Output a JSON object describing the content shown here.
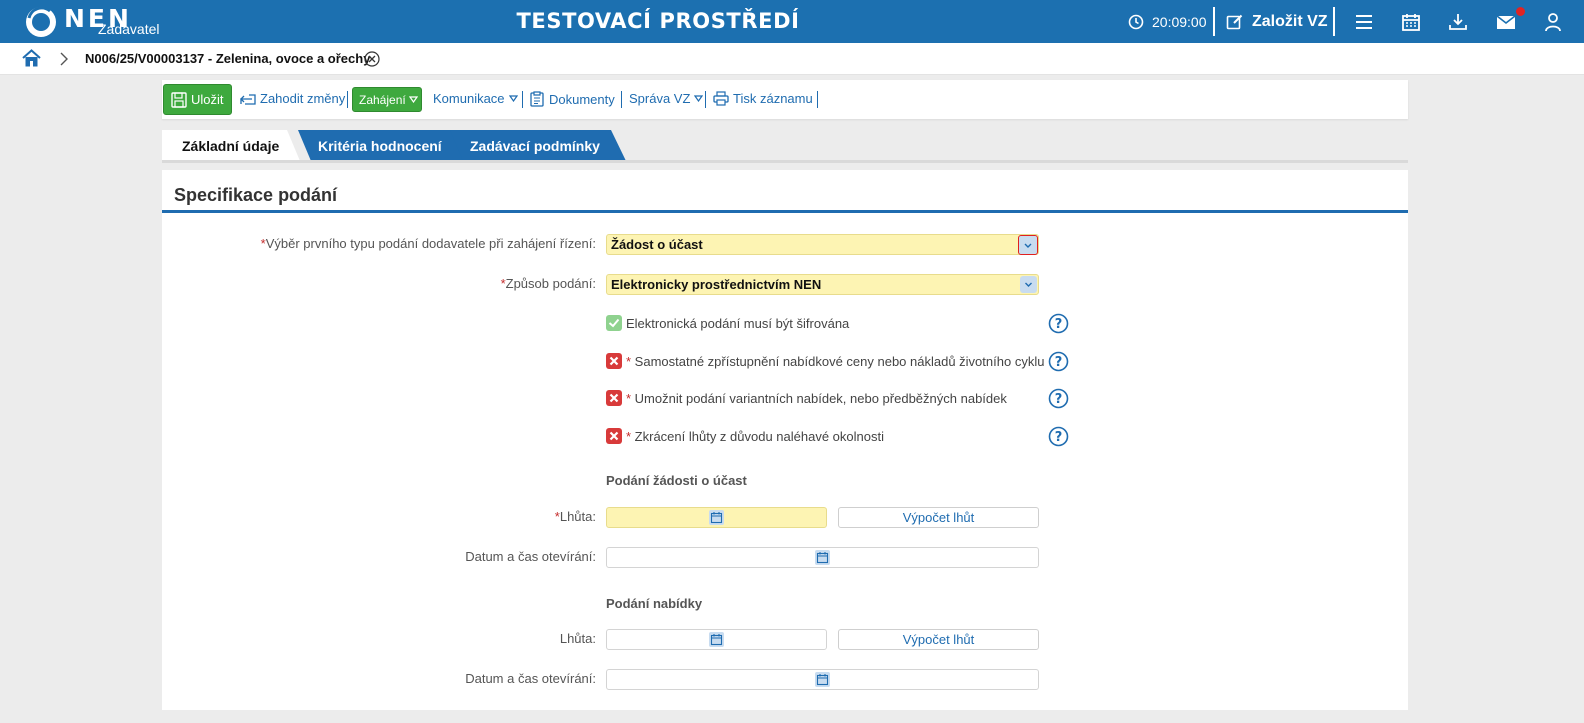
{
  "header": {
    "logo_text": "NEN",
    "logo_sub": "Zadavatel",
    "env_title": "TESTOVACÍ PROSTŘEDÍ",
    "time": "20:09:00",
    "create_label": "Založit VZ"
  },
  "breadcrumb": {
    "title": "N006/25/V00003137 - Zelenina, ovoce a ořechy"
  },
  "toolbar": {
    "save_label": "Uložit",
    "discard_label": "Zahodit změny",
    "start_label": "Zahájení",
    "communication_label": "Komunikace",
    "documents_label": "Dokumenty",
    "management_label": "Správa VZ",
    "print_label": "Tisk záznamu"
  },
  "tabs": [
    {
      "label": "Základní údaje",
      "active": true
    },
    {
      "label": "Kritéria hodnocení",
      "active": false
    },
    {
      "label": "Zadávací podmínky",
      "active": false
    }
  ],
  "form": {
    "section_title": "Specifikace podání",
    "first_type_label": "Výběr prvního typu podání dodavatele při zahájení řízení:",
    "first_type_value": "Žádost o účast",
    "method_label": "Způsob podání:",
    "method_value": "Elektronicky prostřednictvím NEN",
    "checks": [
      {
        "label": "Elektronická podání musí být šifrována",
        "checked": true,
        "required": false
      },
      {
        "label": "Samostatné zpřístupnění nabídkové ceny nebo nákladů životního cyklu",
        "checked": false,
        "required": true
      },
      {
        "label": "Umožnit podání variantních nabídek, nebo předběžných nabídek",
        "checked": false,
        "required": true
      },
      {
        "label": "Zkrácení lhůty z důvodu naléhavé okolnosti",
        "checked": false,
        "required": true
      }
    ],
    "request_heading": "Podání žádosti o účast",
    "deadline_label": "Lhůta:",
    "opening_label": "Datum a čas otevírání:",
    "calc_label": "Výpočet lhůt",
    "offer_heading": "Podání nabídky"
  },
  "colors": {
    "brand_blue": "#1c70b0",
    "green": "#3ea93e",
    "required_yellow": "#fdf4b3"
  }
}
